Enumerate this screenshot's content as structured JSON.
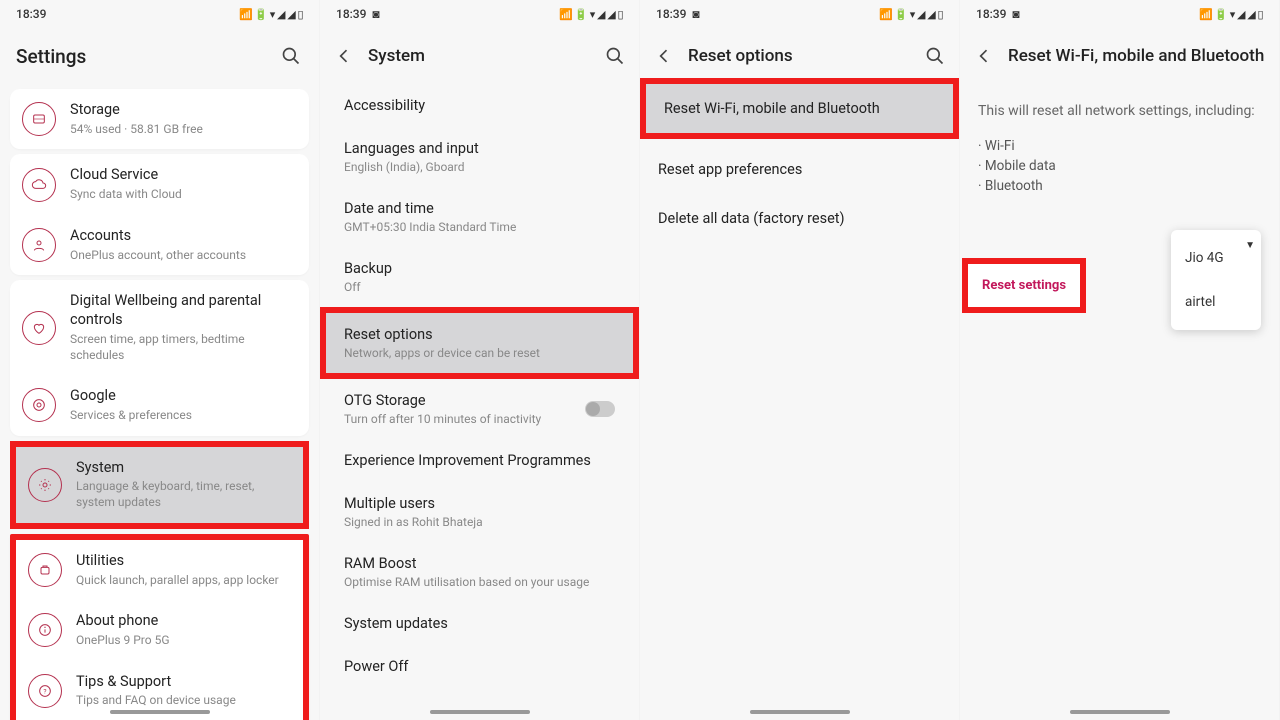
{
  "status": {
    "time": "18:39",
    "icons": "📶 🔋 ▾ ◢ ◢ ▯"
  },
  "s1": {
    "title": "Settings",
    "items": [
      {
        "icon": "storage",
        "title": "Storage",
        "sub": "54% used · 58.81 GB free"
      },
      {
        "icon": "cloud",
        "title": "Cloud Service",
        "sub": "Sync data with Cloud"
      },
      {
        "icon": "account",
        "title": "Accounts",
        "sub": "OnePlus account, other accounts"
      },
      {
        "icon": "wellbeing",
        "title": "Digital Wellbeing and parental controls",
        "sub": "Screen time, app timers, bedtime schedules"
      },
      {
        "icon": "google",
        "title": "Google",
        "sub": "Services & preferences"
      },
      {
        "icon": "utilities",
        "title": "Utilities",
        "sub": "Quick launch, parallel apps, app locker"
      },
      {
        "icon": "system",
        "title": "System",
        "sub": "Language & keyboard, time, reset, system updates"
      },
      {
        "icon": "about",
        "title": "About phone",
        "sub": "OnePlus 9 Pro 5G"
      },
      {
        "icon": "tips",
        "title": "Tips & Support",
        "sub": "Tips and FAQ on device usage"
      }
    ]
  },
  "s2": {
    "title": "System",
    "items": [
      {
        "title": "Accessibility",
        "sub": ""
      },
      {
        "title": "Languages and input",
        "sub": "English (India), Gboard"
      },
      {
        "title": "Date and time",
        "sub": "GMT+05:30 India Standard Time"
      },
      {
        "title": "Backup",
        "sub": "Off"
      },
      {
        "title": "Reset options",
        "sub": "Network, apps or device can be reset",
        "hl": true
      },
      {
        "title": "OTG Storage",
        "sub": "Turn off after 10 minutes of inactivity",
        "toggle": true
      },
      {
        "title": "Experience Improvement Programmes",
        "sub": ""
      },
      {
        "title": "Multiple users",
        "sub": "Signed in as Rohit Bhateja"
      },
      {
        "title": "RAM Boost",
        "sub": "Optimise RAM utilisation based on your usage"
      },
      {
        "title": "System updates",
        "sub": ""
      },
      {
        "title": "Power Off",
        "sub": ""
      }
    ]
  },
  "s3": {
    "title": "Reset options",
    "items": [
      {
        "title": "Reset Wi-Fi, mobile and Bluetooth",
        "hl": true
      },
      {
        "title": "Reset app preferences"
      },
      {
        "title": "Delete all data (factory reset)"
      }
    ]
  },
  "s4": {
    "title": "Reset Wi-Fi, mobile and Bluetooth",
    "desc": "This will reset all network settings, including:",
    "bullets": [
      "Wi-Fi",
      "Mobile data",
      "Bluetooth"
    ],
    "dropdown": [
      "Jio 4G",
      "airtel"
    ],
    "reset_btn": "Reset settings"
  }
}
